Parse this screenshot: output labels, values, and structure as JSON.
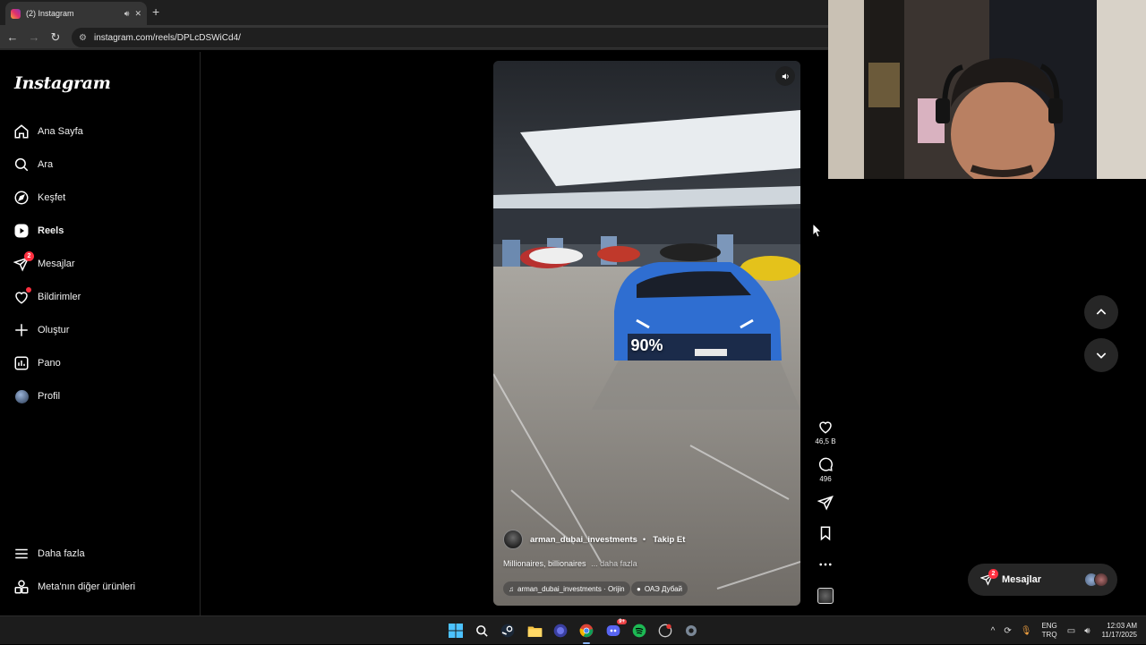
{
  "browser": {
    "tab_title": "(2) Instagram",
    "new_tab": "+",
    "url": "instagram.com/reels/DPLcDSWiCd4/"
  },
  "sidebar": {
    "logo": "Instagram",
    "items": [
      {
        "label": "Ana Sayfa",
        "icon": "home-icon"
      },
      {
        "label": "Ara",
        "icon": "search-icon"
      },
      {
        "label": "Keşfet",
        "icon": "compass-icon"
      },
      {
        "label": "Reels",
        "icon": "reels-icon",
        "active": true
      },
      {
        "label": "Mesajlar",
        "icon": "messenger-icon",
        "badge": "2"
      },
      {
        "label": "Bildirimler",
        "icon": "heart-icon"
      },
      {
        "label": "Oluştur",
        "icon": "plus-icon"
      },
      {
        "label": "Pano",
        "icon": "dashboard-icon"
      },
      {
        "label": "Profil",
        "icon": "avatar"
      }
    ],
    "bottom": [
      {
        "label": "Daha fazla",
        "icon": "menu-icon"
      },
      {
        "label": "Meta'nın diğer ürünleri",
        "icon": "apps-icon"
      }
    ]
  },
  "reel": {
    "overlay_text": "90%",
    "author": "arman_dubai_investments",
    "separator": "•",
    "follow": "Takip Et",
    "caption": "Millionaires, billionaires",
    "caption_more": "... daha fazla",
    "audio": "arman_dubai_investments · Orijin",
    "location": "ОАЭ Дубай"
  },
  "actions": {
    "likes": "46,5 B",
    "comments": "496"
  },
  "messages_pill": {
    "label": "Mesajlar",
    "badge": "2"
  },
  "taskbar": {
    "lang_top": "ENG",
    "lang_bottom": "TRQ",
    "time": "12:03 AM",
    "date": "11/17/2025",
    "discord_badge": "9+"
  },
  "colors": {
    "accent_blue": "#0095f6",
    "notification_red": "#ff3040",
    "background": "#000000"
  }
}
